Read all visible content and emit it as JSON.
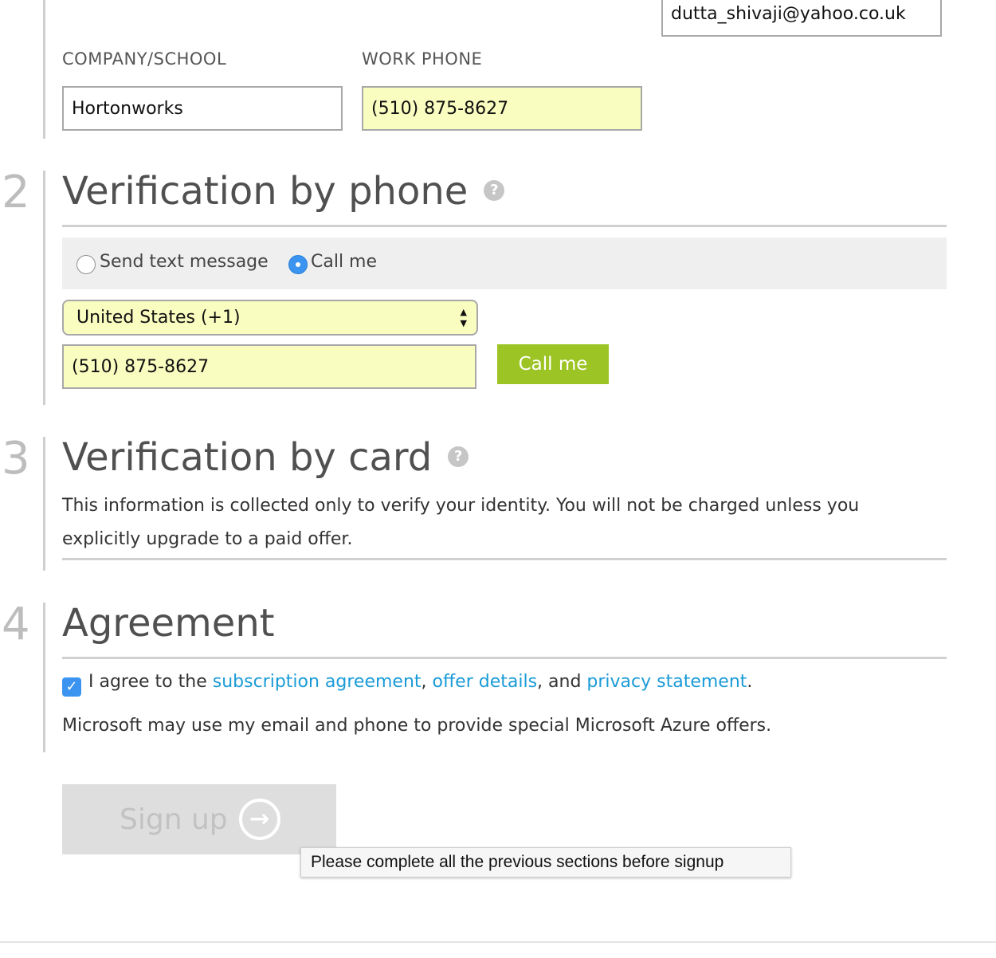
{
  "email_field": {
    "value": "dutta_shivaji@yahoo.co.uk"
  },
  "company": {
    "label": "COMPANY/SCHOOL",
    "value": "Hortonworks"
  },
  "work_phone": {
    "label": "WORK PHONE",
    "value": "(510) 875-8627"
  },
  "phone_verification": {
    "step": "2",
    "title": "Verification by phone",
    "help_icon": "question-icon",
    "option_text": "Send text message",
    "option_call": "Call me",
    "selected_option": "Call me",
    "country": "United States (+1)",
    "phone_value": "(510) 875-8627",
    "call_button": "Call me"
  },
  "card_verification": {
    "step": "3",
    "title": "Verification by card",
    "help_icon": "question-icon",
    "description_line1": "This information is collected only to verify your identity. You will not be charged unless you",
    "description_line2": "explicitly upgrade to a paid offer."
  },
  "agreement": {
    "step": "4",
    "title": "Agreement",
    "checked": true,
    "prefix": "I agree to the ",
    "link_subscription": "subscription agreement",
    "sep1": ", ",
    "link_offer": "offer details",
    "sep2": ", and ",
    "link_privacy": "privacy statement",
    "suffix": ".",
    "offers_note": "Microsoft may use my email and phone to provide special Microsoft Azure offers."
  },
  "signup": {
    "label": "Sign up",
    "tooltip": "Please complete all the previous sections before signup"
  },
  "colors": {
    "autofill": "#fafdc0",
    "accent_green": "#9cc424",
    "link_blue": "#1a9bd7",
    "radio_blue": "#3b95f0"
  }
}
